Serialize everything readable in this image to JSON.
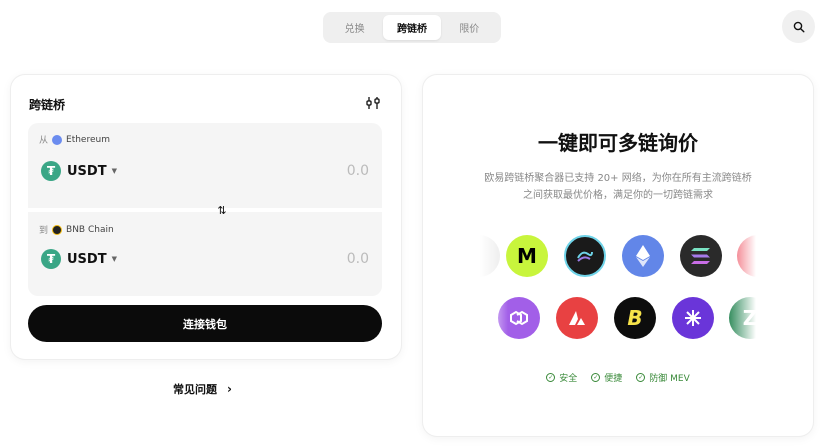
{
  "tabs": [
    {
      "label": "兑换",
      "active": false
    },
    {
      "label": "跨链桥",
      "active": true
    },
    {
      "label": "限价",
      "active": false
    }
  ],
  "bridge": {
    "title": "跨链桥",
    "from": {
      "prefix": "从",
      "chain": "Ethereum",
      "token": "USDT",
      "amount": "0.0"
    },
    "to": {
      "prefix": "到",
      "chain": "BNB Chain",
      "token": "USDT",
      "amount": "0.0"
    },
    "connect_label": "连接钱包"
  },
  "faq_label": "常见问题",
  "promo": {
    "headline": "一键即可多链询价",
    "description_line1": "欧易跨链桥聚合器已支持 20+ 网络，为你在所有主流跨链桥",
    "description_line2": "之间获取最优价格，满足你的一切跨链需求",
    "features": [
      "安全",
      "便捷",
      "防御 MEV"
    ]
  },
  "colors": {
    "tether": "#3aa686",
    "feature_green": "#3a8a3a"
  }
}
